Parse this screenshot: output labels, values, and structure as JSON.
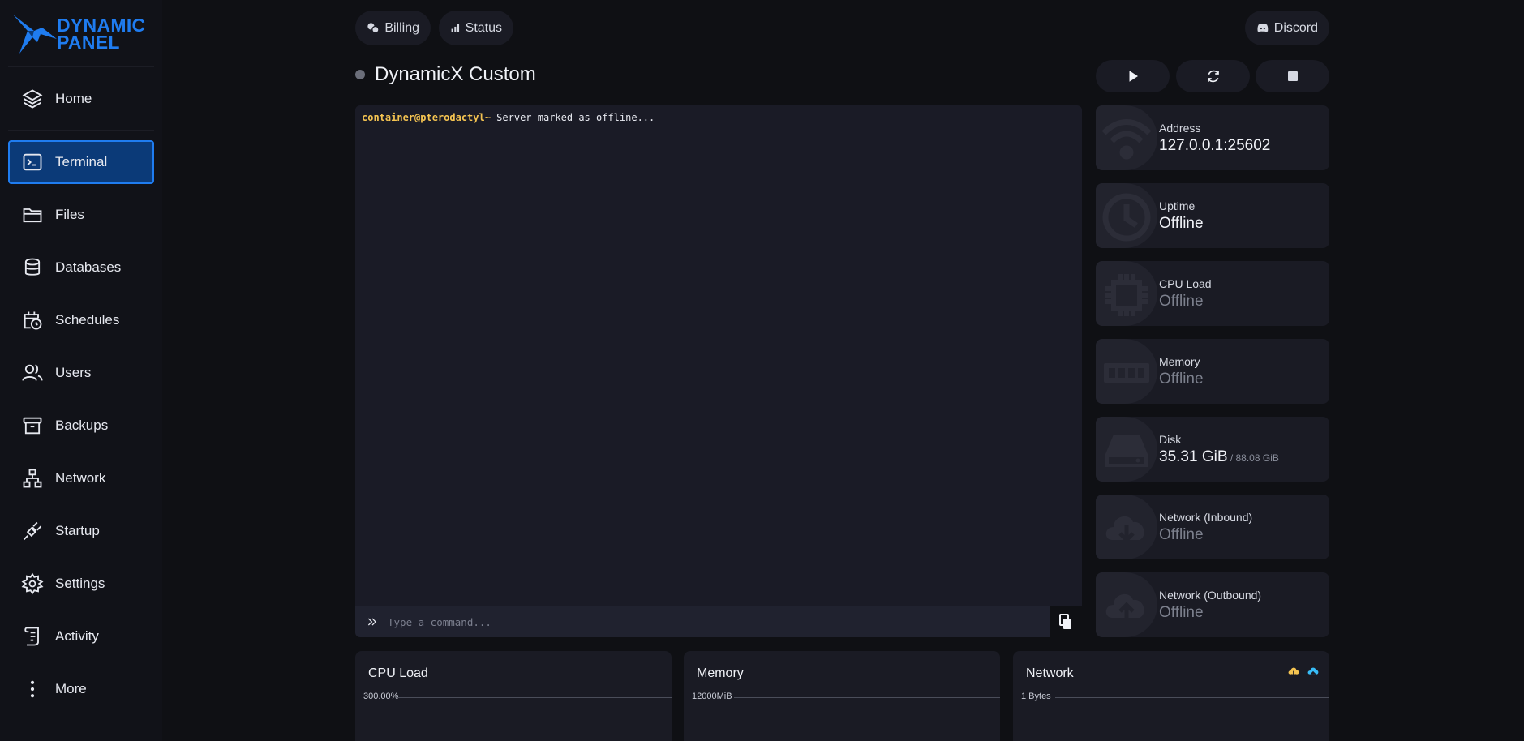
{
  "logo": {
    "line1": "DYNAMIC",
    "line2": "PANEL"
  },
  "nav": [
    {
      "label": "Home",
      "icon": "layers-icon"
    },
    {
      "label": "Terminal",
      "icon": "terminal-icon",
      "active": true
    },
    {
      "label": "Files",
      "icon": "folder-icon"
    },
    {
      "label": "Databases",
      "icon": "database-icon"
    },
    {
      "label": "Schedules",
      "icon": "calendar-clock-icon"
    },
    {
      "label": "Users",
      "icon": "users-icon"
    },
    {
      "label": "Backups",
      "icon": "archive-icon"
    },
    {
      "label": "Network",
      "icon": "network-icon"
    },
    {
      "label": "Startup",
      "icon": "plug-icon"
    },
    {
      "label": "Settings",
      "icon": "gear-icon"
    },
    {
      "label": "Activity",
      "icon": "scroll-icon"
    },
    {
      "label": "More",
      "icon": "more-vertical-icon"
    }
  ],
  "topbar": {
    "billing": "Billing",
    "status": "Status",
    "discord": "Discord"
  },
  "server": {
    "name": "DynamicX Custom",
    "status_color": "#6b6e7a"
  },
  "terminal": {
    "prompt": "container@pterodactyl~",
    "message": " Server marked as offline...",
    "input_placeholder": "Type a command..."
  },
  "stats": [
    {
      "label": "Address",
      "value": "127.0.0.1:25602",
      "icon": "wifi-icon"
    },
    {
      "label": "Uptime",
      "value": "Offline",
      "icon": "clock-icon"
    },
    {
      "label": "CPU Load",
      "value": "Offline",
      "icon": "cpu-icon"
    },
    {
      "label": "Memory",
      "value": "Offline",
      "icon": "memory-icon"
    },
    {
      "label": "Disk",
      "value": "35.31 GiB",
      "limit": " / 88.08 GiB",
      "icon": "hdd-icon"
    },
    {
      "label": "Network (Inbound)",
      "value": "Offline",
      "icon": "cloud-download-icon"
    },
    {
      "label": "Network (Outbound)",
      "value": "Offline",
      "icon": "cloud-upload-icon"
    }
  ],
  "graphs": {
    "cpu": {
      "title": "CPU Load",
      "axis": "300.00%"
    },
    "memory": {
      "title": "Memory",
      "axis": "12000MiB"
    },
    "network": {
      "title": "Network",
      "axis": "1 Bytes"
    }
  },
  "colors": {
    "accent": "#1f7cf0",
    "prompt": "#f5c451",
    "inbound": "#f5c451",
    "outbound": "#38bdf8"
  }
}
